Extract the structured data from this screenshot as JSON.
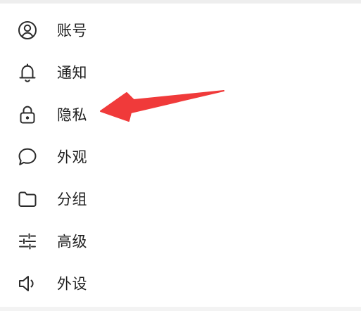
{
  "menu": {
    "items": [
      {
        "label": "账号",
        "icon": "user-circle-icon"
      },
      {
        "label": "通知",
        "icon": "bell-icon"
      },
      {
        "label": "隐私",
        "icon": "lock-icon"
      },
      {
        "label": "外观",
        "icon": "chat-bubble-icon"
      },
      {
        "label": "分组",
        "icon": "folder-icon"
      },
      {
        "label": "高级",
        "icon": "sliders-icon"
      },
      {
        "label": "外设",
        "icon": "speaker-icon"
      }
    ]
  },
  "annotation": {
    "arrow_color": "#f03a3a",
    "points_to": "隐私"
  },
  "colors": {
    "icon": "#2b2b2b",
    "text": "#1f1f1f",
    "background": "#ffffff"
  }
}
